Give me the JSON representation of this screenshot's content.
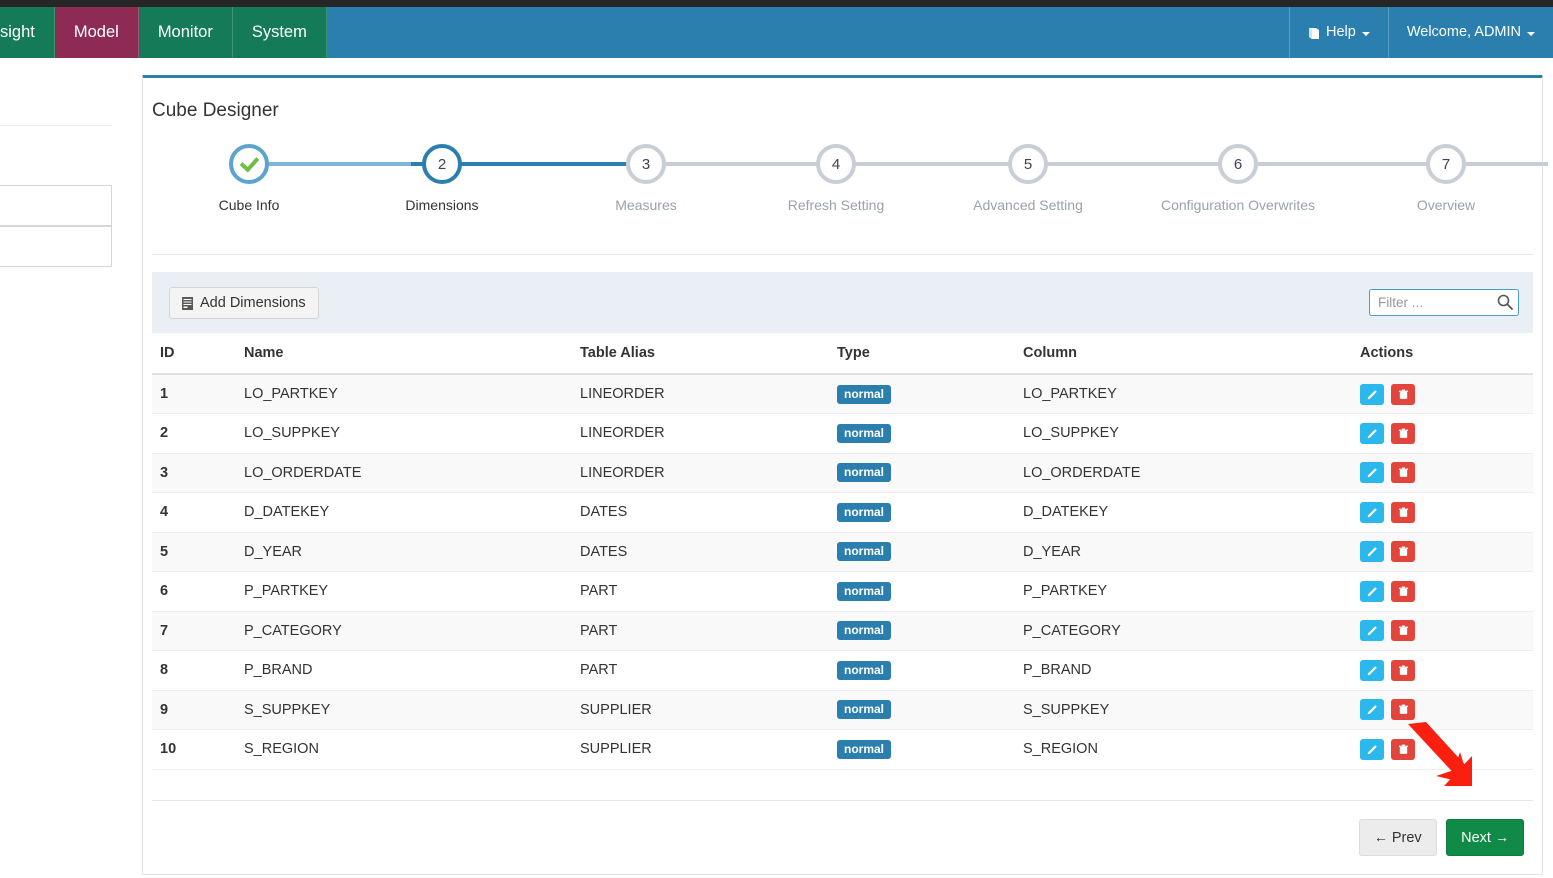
{
  "navbar": {
    "left_items": [
      {
        "label": "sight",
        "active": false,
        "clipped": true
      },
      {
        "label": "Model",
        "active": true,
        "clipped": false
      },
      {
        "label": "Monitor",
        "active": false,
        "clipped": false
      },
      {
        "label": "System",
        "active": false,
        "clipped": false
      }
    ],
    "help_label": "Help",
    "help_icon": "book-icon",
    "user_label": "Welcome, ADMIN",
    "colors": {
      "bar": "#2a7fae",
      "nav_item": "#147a58",
      "active_item": "#8d2b55",
      "top_strip": "#262626"
    }
  },
  "page": {
    "title": "Cube Designer"
  },
  "stepper": {
    "steps": [
      {
        "num": "1",
        "label": "Cube Info",
        "state": "done"
      },
      {
        "num": "2",
        "label": "Dimensions",
        "state": "current"
      },
      {
        "num": "3",
        "label": "Measures",
        "state": "todo"
      },
      {
        "num": "4",
        "label": "Refresh Setting",
        "state": "todo"
      },
      {
        "num": "5",
        "label": "Advanced Setting",
        "state": "todo"
      },
      {
        "num": "6",
        "label": "Configuration Overwrites",
        "state": "todo"
      },
      {
        "num": "7",
        "label": "Overview",
        "state": "todo"
      }
    ]
  },
  "toolbar": {
    "add_label": "Add Dimensions",
    "add_icon": "list-icon",
    "filter_placeholder": "Filter ...",
    "filter_value": "",
    "search_icon": "search-icon"
  },
  "table": {
    "headers": [
      "ID",
      "Name",
      "Table Alias",
      "Type",
      "Column",
      "Actions"
    ],
    "rows": [
      {
        "id": "1",
        "name": "LO_PARTKEY",
        "alias": "LINEORDER",
        "type": "normal",
        "column": "LO_PARTKEY"
      },
      {
        "id": "2",
        "name": "LO_SUPPKEY",
        "alias": "LINEORDER",
        "type": "normal",
        "column": "LO_SUPPKEY"
      },
      {
        "id": "3",
        "name": "LO_ORDERDATE",
        "alias": "LINEORDER",
        "type": "normal",
        "column": "LO_ORDERDATE"
      },
      {
        "id": "4",
        "name": "D_DATEKEY",
        "alias": "DATES",
        "type": "normal",
        "column": "D_DATEKEY"
      },
      {
        "id": "5",
        "name": "D_YEAR",
        "alias": "DATES",
        "type": "normal",
        "column": "D_YEAR"
      },
      {
        "id": "6",
        "name": "P_PARTKEY",
        "alias": "PART",
        "type": "normal",
        "column": "P_PARTKEY"
      },
      {
        "id": "7",
        "name": "P_CATEGORY",
        "alias": "PART",
        "type": "normal",
        "column": "P_CATEGORY"
      },
      {
        "id": "8",
        "name": "P_BRAND",
        "alias": "PART",
        "type": "normal",
        "column": "P_BRAND"
      },
      {
        "id": "9",
        "name": "S_SUPPKEY",
        "alias": "SUPPLIER",
        "type": "normal",
        "column": "S_SUPPKEY"
      },
      {
        "id": "10",
        "name": "S_REGION",
        "alias": "SUPPLIER",
        "type": "normal",
        "column": "S_REGION"
      }
    ],
    "edit_icon": "pencil-icon",
    "delete_icon": "trash-icon",
    "badge_color": "#2a7fae",
    "edit_color": "#2bb8ec",
    "delete_color": "#e1453c"
  },
  "footer": {
    "prev_label": "Prev",
    "next_label": "Next",
    "prev_arrow": "←",
    "next_arrow": "→",
    "next_color": "#0f8a47"
  },
  "annotation": {
    "arrow_color": "#fb1f10"
  }
}
